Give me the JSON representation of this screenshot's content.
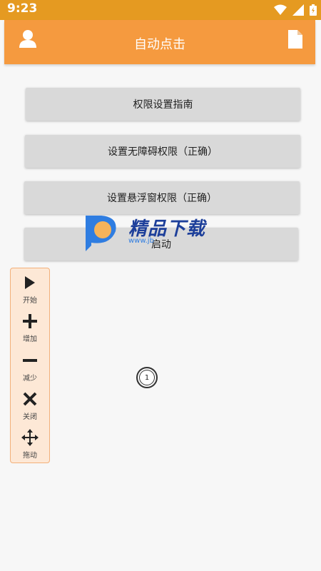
{
  "status_bar": {
    "time": "9:23",
    "icons": [
      "wifi-icon",
      "signal-icon",
      "battery-icon"
    ]
  },
  "app_bar": {
    "title": "自动点击",
    "left_icon": "user-icon",
    "right_icon": "document-icon",
    "color": "#f59a3f"
  },
  "buttons": {
    "guide": "权限设置指南",
    "accessibility": "设置无障碍权限（正确）",
    "overlay": "设置悬浮窗权限（正确）",
    "start": "启动"
  },
  "watermark": {
    "brand": "精品下载",
    "url": "www.jb"
  },
  "float_panel": {
    "tools": [
      {
        "icon": "play-icon",
        "label": "开始"
      },
      {
        "icon": "plus-icon",
        "label": "增加"
      },
      {
        "icon": "minus-icon",
        "label": "减少"
      },
      {
        "icon": "close-icon",
        "label": "关闭"
      },
      {
        "icon": "move-icon",
        "label": "拖动"
      }
    ]
  },
  "click_target": {
    "number": "1"
  }
}
